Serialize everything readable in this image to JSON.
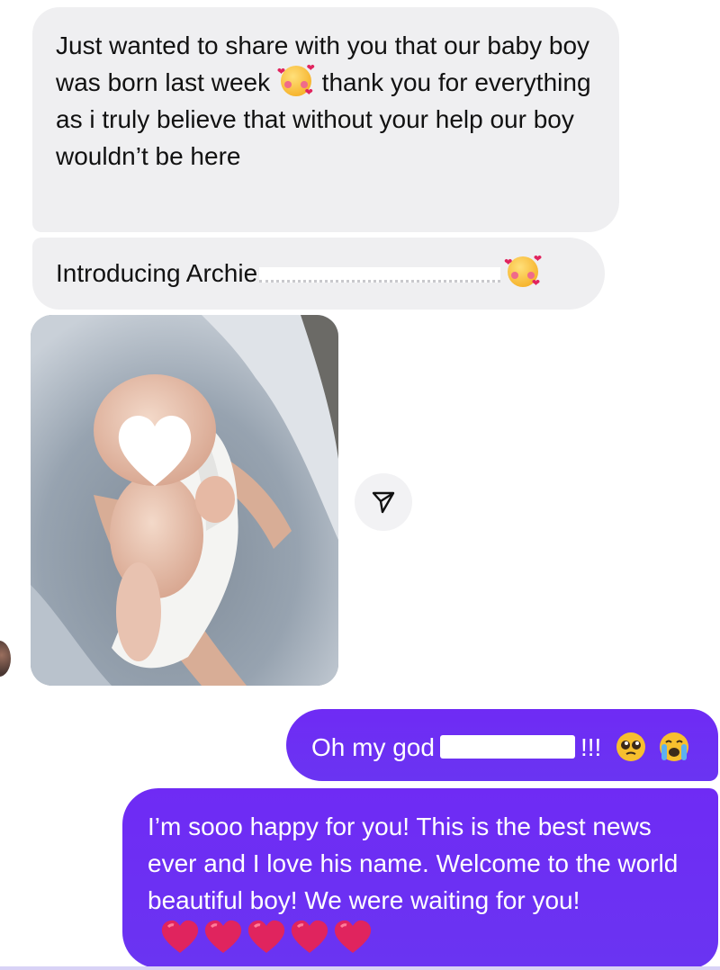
{
  "conversation": {
    "received": [
      {
        "text": "Just wanted to share with you that our baby boy was born last week",
        "text_after_emoji": "thank you for everything as i truly believe that without your help our boy wouldn’t be here",
        "emoji": "smiling-face-with-hearts"
      },
      {
        "text": "Introducing Archie",
        "redacted": true,
        "emoji": "smiling-face-with-hearts"
      }
    ],
    "photo": {
      "subject": "newborn-baby-photo",
      "overlay_icon": "white-heart-icon"
    },
    "share_icon": "send-icon",
    "sent": [
      {
        "text": "Oh my god",
        "suffix": "!!!",
        "redacted": true,
        "emojis": [
          "pleading-face",
          "loudly-crying-face"
        ]
      },
      {
        "text": "I’m sooo happy for you! This is the best news ever and I love his name. Welcome to the world beautiful boy! We were waiting for you!",
        "emojis": [
          "red-heart",
          "red-heart",
          "red-heart",
          "red-heart",
          "red-heart"
        ]
      }
    ]
  },
  "colors": {
    "received_bubble": "#efeff1",
    "sent_bubble": "#6b2cf5",
    "heart": "#e0245e"
  }
}
